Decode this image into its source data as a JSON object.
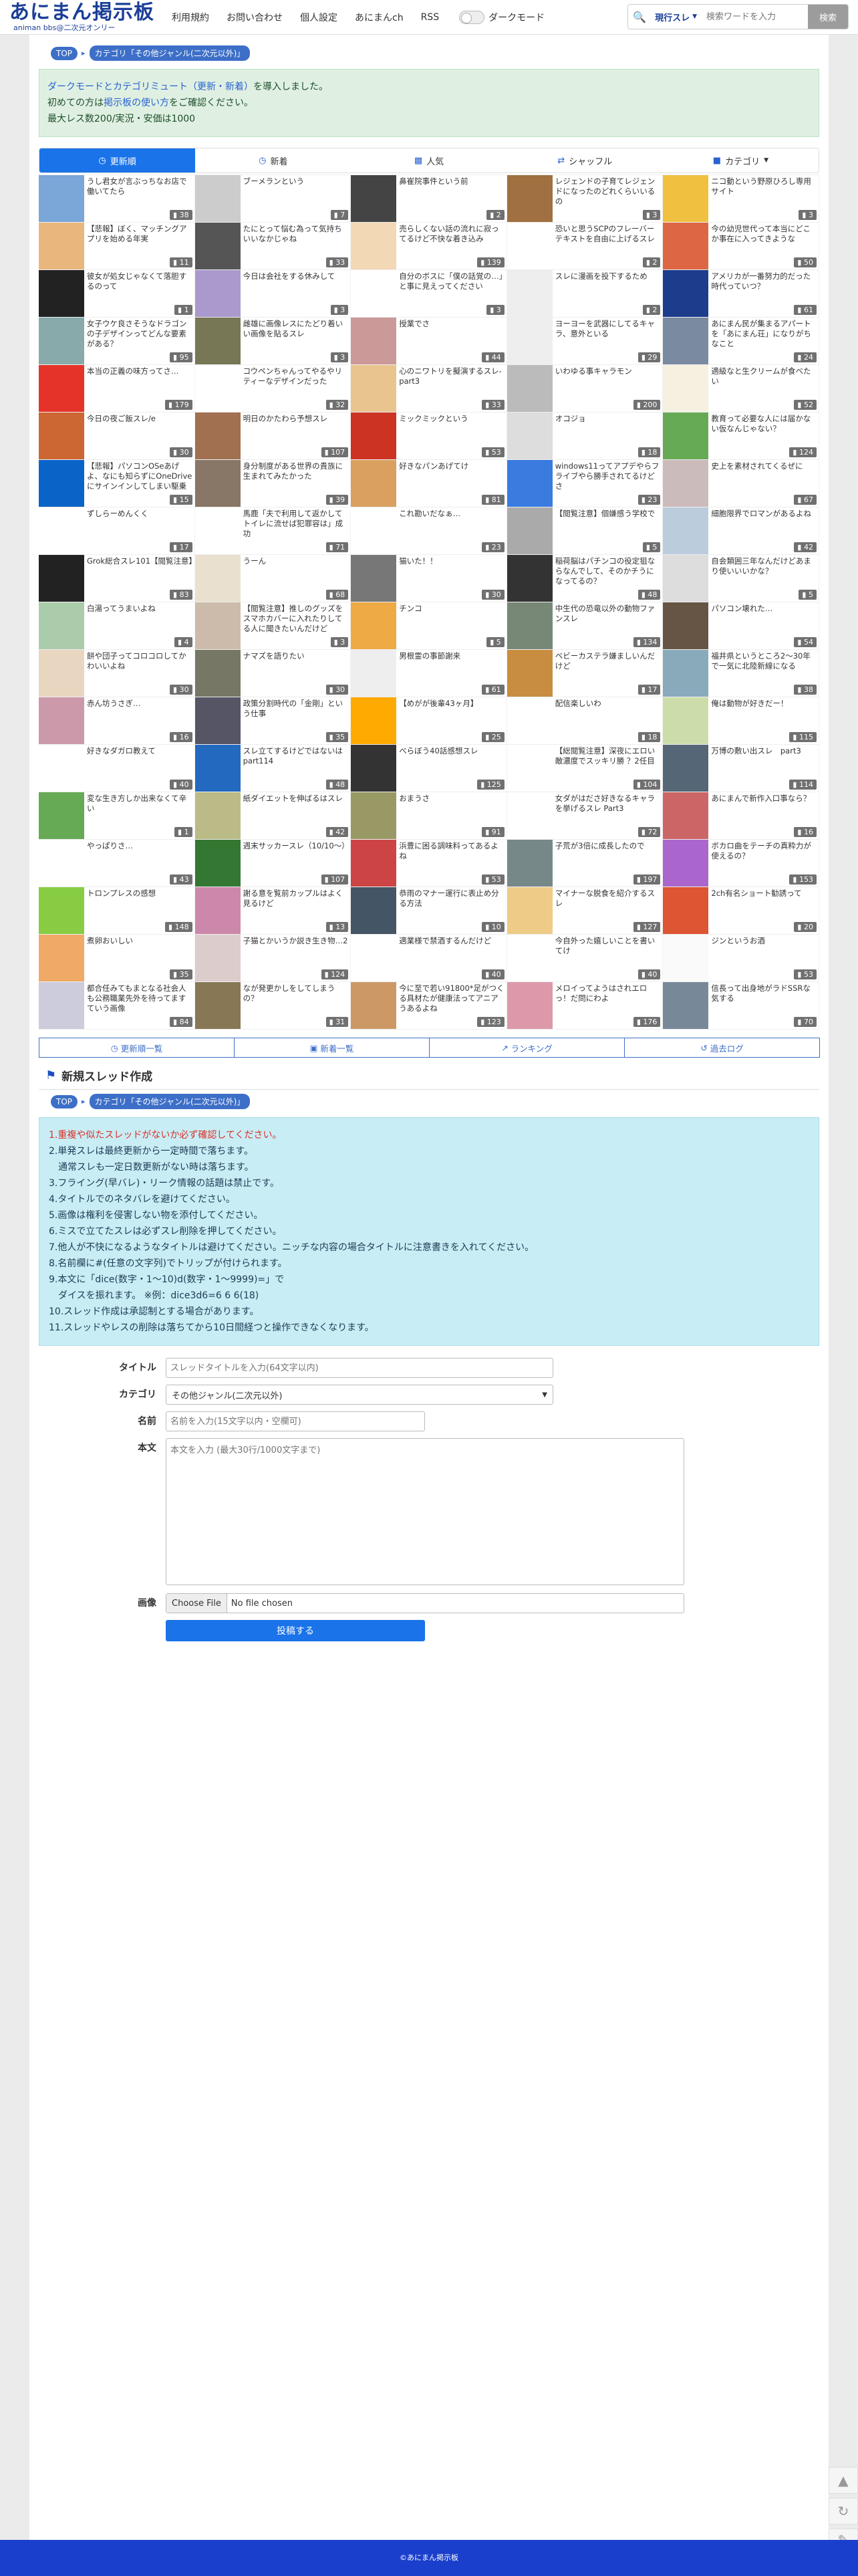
{
  "header": {
    "logo": "あにまん掲示板",
    "logo_sub": "animan bbs@二次元オンリー",
    "nav": [
      "利用規約",
      "お問い合わせ",
      "個人設定",
      "あにまんch",
      "RSS"
    ],
    "darkmode": "ダークモード",
    "search_scope": "現行スレ",
    "search_placeholder": "検索ワードを入力",
    "search_button": "検索"
  },
  "breadcrumb": {
    "top": "TOP",
    "category": "カテゴリ「その他ジャンル(二次元以外)」"
  },
  "notice": {
    "line1_hl": "ダークモードとカテゴリミュート（更新・新着）",
    "line1_rest": "を導入しました。",
    "line2_a": "初めての方は",
    "line2_hl": "掲示板の使い方",
    "line2_b": "をご確認ください。",
    "line3": "最大レス数200/実況・安価は1000"
  },
  "tabs": [
    "更新順",
    "新着",
    "人気",
    "シャッフル",
    "カテゴリ"
  ],
  "threads": [
    {
      "t": "うし君女が言ぶっちなお店で働いてたら",
      "c": "38",
      "bg": "#7aa6d8"
    },
    {
      "t": "ブーメランという",
      "c": "7",
      "bg": "#ccc"
    },
    {
      "t": "鼻崔院事件という前",
      "c": "2",
      "bg": "#444"
    },
    {
      "t": "レジェンドの子育てレジェンドになったのどれくらいいるの",
      "c": "3",
      "bg": "#a07040"
    },
    {
      "t": "ニコ動という野原ひろし専用サイト",
      "c": "3",
      "bg": "#f0c040"
    },
    {
      "t": "【悲報】ぼく、マッチングアプリを始める年実",
      "c": "11",
      "bg": "#e9b77d"
    },
    {
      "t": "たにとって悩む為って気持ちいいなかじゃね",
      "c": "33",
      "bg": "#555"
    },
    {
      "t": "売らしくない話の流れに寂ってるけど不快な着き込み",
      "c": "139",
      "bg": "#f3d8b6"
    },
    {
      "t": "恐いと思うSCPのフレーバーテキストを自由に上げるスレ",
      "c": "2",
      "bg": "#fff"
    },
    {
      "t": "今の幼児世代って本当にどこか事在に入ってきような",
      "c": "50",
      "bg": "#d64"
    },
    {
      "t": "彼女が処女じゃなくて落胆するのって",
      "c": "1",
      "bg": "#222"
    },
    {
      "t": "今日は会社をする休みして",
      "c": "3",
      "bg": "#a9c"
    },
    {
      "t": "自分のボスに「僕の話覚の…」と事に見えってください",
      "c": "3",
      "bg": "#fff"
    },
    {
      "t": "スレに漫画を投下するため",
      "c": "2",
      "bg": "#eee"
    },
    {
      "t": "アメリカが一番努力的だった時代っていつ？",
      "c": "61",
      "bg": "#1c3c8c"
    },
    {
      "t": "女子ウケ良さそうなドラゴンの子デザインってどんな要素がある？",
      "c": "95",
      "bg": "#8aa"
    },
    {
      "t": "雌雄に画像レスにたどり着いい画像を貼るスレ",
      "c": "3",
      "bg": "#775"
    },
    {
      "t": "授業でさ",
      "c": "44",
      "bg": "#c99"
    },
    {
      "t": "ヨーヨーを武器にしてるキャラ、意外といる",
      "c": "29",
      "bg": "#eee"
    },
    {
      "t": "あにまん民が集まるアパートを「あにまん荘」になりがちなこと",
      "c": "24",
      "bg": "#7a8aa0"
    },
    {
      "t": "本当の正義の味方ってさ…",
      "c": "179",
      "bg": "#e5332a"
    },
    {
      "t": "コウペンちゃんってやるやリティーなデザインだった",
      "c": "32",
      "bg": "#fff"
    },
    {
      "t": "心のニワトリを擬演するスレ-part3",
      "c": "33",
      "bg": "#e9c48f"
    },
    {
      "t": "いわゆる事キャラモン",
      "c": "200",
      "bg": "#bbb"
    },
    {
      "t": "適級なと生クリームが食べたい",
      "c": "52",
      "bg": "#f5f0e0"
    },
    {
      "t": "今日の夜ご飯スレ/e",
      "c": "30",
      "bg": "#c63"
    },
    {
      "t": "明日のかたわら予想スレ",
      "c": "107",
      "bg": "#a07050"
    },
    {
      "t": "ミックミックという",
      "c": "53",
      "bg": "#c32"
    },
    {
      "t": "オコジョ",
      "c": "18",
      "bg": "#ddd"
    },
    {
      "t": "教育って必要な人には届かない仮なんじゃない？",
      "c": "124",
      "bg": "#6a5"
    },
    {
      "t": "【悲報】パソコンOSeあげよ、なにも知らずにOneDriveにサインインしてしまい駆乗状に",
      "c": "15",
      "bg": "#0a64c8"
    },
    {
      "t": "身分制度がある世界の貴族に生まれてみたかった",
      "c": "39",
      "bg": "#876"
    },
    {
      "t": "好きなパンあげてけ",
      "c": "81",
      "bg": "#d9a060"
    },
    {
      "t": "windows11ってアプデやらフライブやら勝手されてるけどさ",
      "c": "23",
      "bg": "#3a7be0"
    },
    {
      "t": "史上を素材されてくるぜに",
      "c": "67",
      "bg": "#cbb"
    },
    {
      "t": "ずしらーめんくく",
      "c": "17",
      "bg": "#fff"
    },
    {
      "t": "馬鹿「夫で利用して返かしてトイレに流せば犯罪容は」成功",
      "c": "71",
      "bg": "#fff"
    },
    {
      "t": "これ勘いだなぁ…",
      "c": "23",
      "bg": "#fff"
    },
    {
      "t": "【閲覧注意】個嫌感う学校で",
      "c": "5",
      "bg": "#aaa"
    },
    {
      "t": "細胞限界でロマンがあるよね",
      "c": "42",
      "bg": "#bcd"
    },
    {
      "t": "Grok総合スレ101【閲覧注意】",
      "c": "83",
      "bg": "#222"
    },
    {
      "t": "うーん",
      "c": "68",
      "bg": "#e9e0d0"
    },
    {
      "t": "猫いた！！",
      "c": "30",
      "bg": "#777"
    },
    {
      "t": "稲荷脳はパチンコの役定狙ならなんでして、そのかチうになってるの？",
      "c": "48",
      "bg": "#333"
    },
    {
      "t": "自会類囲三年なんだけどあまり使いいいかな？",
      "c": "5",
      "bg": "#ddd"
    },
    {
      "t": "白湯ってうまいよね",
      "c": "4",
      "bg": "#aca"
    },
    {
      "t": "【閲覧注意】推しのグッズをスマホカバーに入れたりしてる人に聞きたいんだけど",
      "c": "3",
      "bg": "#cba"
    },
    {
      "t": "チンコ",
      "c": "5",
      "bg": "#ea4"
    },
    {
      "t": "中生代の恐竜以外の動物ファンスレ",
      "c": "134",
      "bg": "#787"
    },
    {
      "t": "パソコン壊れた…",
      "c": "54",
      "bg": "#654"
    },
    {
      "t": "餅や団子ってコロコロしてかわいいよね",
      "c": "30",
      "bg": "#e8d6c0"
    },
    {
      "t": "ナマズを語りたい",
      "c": "30",
      "bg": "#776"
    },
    {
      "t": "男根霊の事節謝来",
      "c": "61",
      "bg": "#eee"
    },
    {
      "t": "ベビーカステラ嫌ましいんだけど",
      "c": "17",
      "bg": "#c88d40"
    },
    {
      "t": "福井県というところ2〜30年で一気に北陸新線になる",
      "c": "38",
      "bg": "#8ab"
    },
    {
      "t": "赤ん坊うさぎ…",
      "c": "16",
      "bg": "#c9a"
    },
    {
      "t": "政策分割時代の「金剛」という仕事",
      "c": "35",
      "bg": "#556"
    },
    {
      "t": "【めがが後輩43ヶ月】",
      "c": "25",
      "bg": "#fa0"
    },
    {
      "t": "配信楽しいわ",
      "c": "18",
      "bg": "#fff"
    },
    {
      "t": "俺は動物が好きだー！",
      "c": "115",
      "bg": "#cda"
    },
    {
      "t": "好きなダガロ教えて",
      "c": "40",
      "bg": "#fff"
    },
    {
      "t": "スレ立てするけどではないはpart114",
      "c": "48",
      "bg": "#2469c0"
    },
    {
      "t": "べらぼう40話感想スレ",
      "c": "125",
      "bg": "#333"
    },
    {
      "t": "【総閲覧注意】深夜にエロい敵濃度でスッキリ勝 ？2任目",
      "c": "104",
      "bg": "#fff"
    },
    {
      "t": "万博の敷い出スレ　part3",
      "c": "114",
      "bg": "#567"
    },
    {
      "t": "変な生き方しか出来なくて辛い",
      "c": "1",
      "bg": "#6a5"
    },
    {
      "t": "紙ダイエットを伸ばるはスレ",
      "c": "42",
      "bg": "#bb8"
    },
    {
      "t": "おまうさ",
      "c": "91",
      "bg": "#996"
    },
    {
      "t": "女ダがはださ好きなるキャラを挙げるスレ Part3",
      "c": "72",
      "bg": "#fff"
    },
    {
      "t": "あにまんで新作入口事なら？",
      "c": "16",
      "bg": "#c66"
    },
    {
      "t": "やっぱりさ…",
      "c": "43",
      "bg": "#fff"
    },
    {
      "t": "週末サッカースレ（10/10〜）",
      "c": "107",
      "bg": "#373"
    },
    {
      "t": "浜豊に困る調味料ってあるよね",
      "c": "53",
      "bg": "#c44"
    },
    {
      "t": "子荒が3倍に成長したので",
      "c": "197",
      "bg": "#788"
    },
    {
      "t": "ボカロ曲をテーチの真粋力が使えるの？",
      "c": "153",
      "bg": "#a6c"
    },
    {
      "t": "トロンプレスの感想",
      "c": "148",
      "bg": "#8c4"
    },
    {
      "t": "謝る意を覧前カップルはよく見るけど",
      "c": "13",
      "bg": "#c8a"
    },
    {
      "t": "恭雨のマナー運行に表止め分る方法",
      "c": "10",
      "bg": "#456"
    },
    {
      "t": "マイナーな脱食を紹介するスレ",
      "c": "127",
      "bg": "#ec8"
    },
    {
      "t": "2ch有名ショート勧誘って",
      "c": "20",
      "bg": "#d53"
    },
    {
      "t": "煮卵おいしい",
      "c": "35",
      "bg": "#ea6"
    },
    {
      "t": "子猫とかいうか説き生き物…2",
      "c": "124",
      "bg": "#dcc"
    },
    {
      "t": "適業様で禁酒するんだけど",
      "c": "40",
      "bg": "#fff"
    },
    {
      "t": "今自外った嬉しいことを書いてけ",
      "c": "40",
      "bg": "#fff"
    },
    {
      "t": "ジンというお酒",
      "c": "53",
      "bg": "#fafafa"
    },
    {
      "t": "都合任みてもまとなる社会人も公務職業先外を待ってますていう画像",
      "c": "84",
      "bg": "#ccd"
    },
    {
      "t": "なが発更かしをしてしまうの？",
      "c": "31",
      "bg": "#875"
    },
    {
      "t": "今に至で若い91800*足がつくる具材たが健康法ってアニアうあるよね",
      "c": "123",
      "bg": "#c96"
    },
    {
      "t": "メロイってようはされエロっ！だ問にわよ",
      "c": "176",
      "bg": "#d9a"
    },
    {
      "t": "信長って出身地がラドSSRな気する",
      "c": "70",
      "bg": "#789"
    }
  ],
  "subnav": [
    "更新順一覧",
    "新着一覧",
    "ランキング",
    "過去ログ"
  ],
  "new_thread": {
    "heading": "新規スレッド作成"
  },
  "rules": [
    "1.重複や似たスレッドがないか必ず確認してください。",
    "2.単発スレは最終更新から一定時間で落ちます。",
    "　通常スレも一定日数更新がない時は落ちます。",
    "3.フライング(早バレ)・リーク情報の話題は禁止です。",
    "4.タイトルでのネタバレを避けてください。",
    "5.画像は権利を侵害しない物を添付してください。",
    "6.ミスで立てたスレは必ずスレ削除を押してください。",
    "7.他人が不快になるようなタイトルは避けてください。ニッチな内容の場合タイトルに注意書きを入れてください。",
    "8.名前欄に#(任意の文字列)でトリップが付けられます。",
    "9.本文に「dice(数字・1〜10)d(数字・1〜9999)=」で",
    "　ダイスを振れます。 ※例：dice3d6=6 6 6(18)",
    "10.スレッド作成は承認制とする場合があります。",
    "11.スレッドやレスの削除は落ちてから10日間経つと操作できなくなります。"
  ],
  "form": {
    "title_label": "タイトル",
    "title_placeholder": "スレッドタイトルを入力(64文字以内)",
    "category_label": "カテゴリ",
    "category_value": "その他ジャンル(二次元以外)",
    "name_label": "名前",
    "name_placeholder": "名前を入力(15文字以内・空欄可)",
    "body_label": "本文",
    "body_placeholder": "本文を入力 (最大30行/1000文字まで)",
    "image_label": "画像",
    "file_button": "Choose File",
    "file_status": "No file chosen",
    "submit": "投稿する"
  },
  "footer": "©あにまん掲示板"
}
